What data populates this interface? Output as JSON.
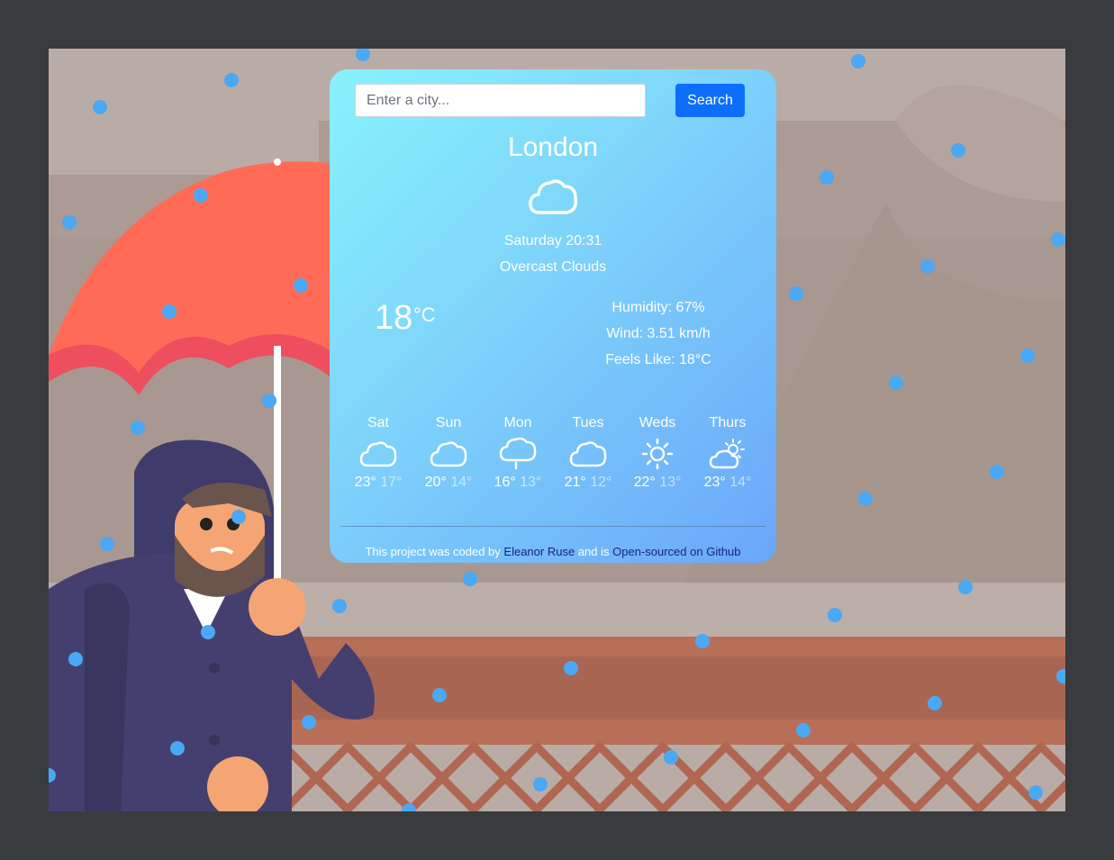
{
  "search": {
    "placeholder": "Enter a city...",
    "value": "",
    "button_label": "Search"
  },
  "weather": {
    "city": "London",
    "icon": "cloud-icon",
    "datetime": "Saturday 20:31",
    "description": "Overcast Clouds",
    "temperature": "18",
    "unit": "°C",
    "humidity": "Humidity: 67%",
    "wind": "Wind: 3.51 km/h",
    "feels_like": "Feels Like: 18°C"
  },
  "forecast": [
    {
      "day": "Sat",
      "icon": "cloud-icon",
      "max": "23°",
      "min": "17°"
    },
    {
      "day": "Sun",
      "icon": "cloud-icon",
      "max": "20°",
      "min": "14°"
    },
    {
      "day": "Mon",
      "icon": "rain-cloud-icon",
      "max": "16°",
      "min": "13°"
    },
    {
      "day": "Tues",
      "icon": "cloud-icon",
      "max": "21°",
      "min": "12°"
    },
    {
      "day": "Weds",
      "icon": "sun-icon",
      "max": "22°",
      "min": "13°"
    },
    {
      "day": "Thurs",
      "icon": "partly-cloudy-icon",
      "max": "23°",
      "min": "14°"
    }
  ],
  "footer": {
    "prefix": "This project was coded by",
    "author": "Eleanor Ruse",
    "middle": "and is",
    "link": "Open-sourced on Github"
  },
  "colors": {
    "search_button": "#0d6efd",
    "card_gradient_start": "#88f2fb",
    "card_gradient_end": "#6aa6f9",
    "raindrop": "#4aa8f5",
    "umbrella": "#ff6b57"
  }
}
